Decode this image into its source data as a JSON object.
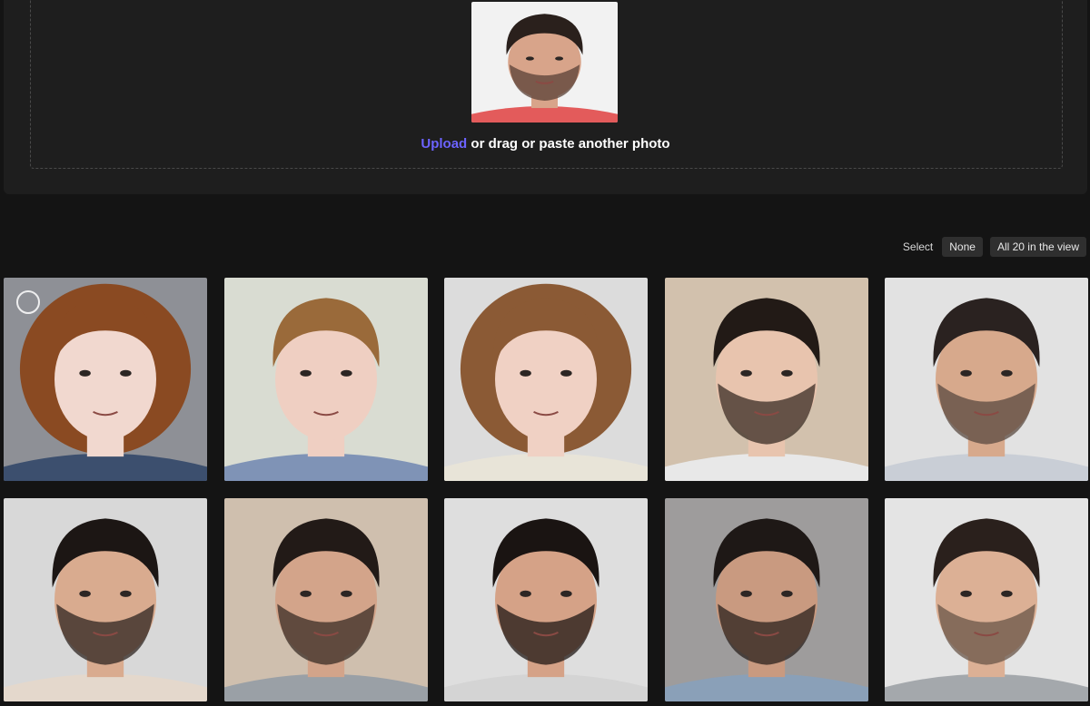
{
  "upload": {
    "link_label": "Upload",
    "rest_label": " or drag or paste another photo"
  },
  "select_bar": {
    "label": "Select",
    "none_label": "None",
    "all_label": "All 20 in the view"
  },
  "grid": {
    "items": [
      {
        "bg": "#8e9096",
        "skin": "#f1d8cf",
        "hair": "#8a4a22",
        "shirt": "#3c4f6e",
        "beard": null,
        "long_hair": true
      },
      {
        "bg": "#d9dcd2",
        "skin": "#efcfc2",
        "hair": "#9a6a3a",
        "shirt": "#7f93b6",
        "beard": null,
        "long_hair": false
      },
      {
        "bg": "#dcdcdc",
        "skin": "#f0d1c4",
        "hair": "#8b5a35",
        "shirt": "#e8e4d8",
        "beard": null,
        "long_hair": true
      },
      {
        "bg": "#d2c1ad",
        "skin": "#e8c4ae",
        "hair": "#221a16",
        "shirt": "#e8e8e8",
        "beard": "#3a2c24",
        "long_hair": false
      },
      {
        "bg": "#e2e2e2",
        "skin": "#d7a98c",
        "hair": "#2a2220",
        "shirt": "#c9ced6",
        "beard": "#5a4a40",
        "long_hair": false
      },
      {
        "bg": "#d8d8d8",
        "skin": "#d9ab8f",
        "hair": "#1c1614",
        "shirt": "#e4d8cc",
        "beard": "#2e2420",
        "long_hair": false
      },
      {
        "bg": "#cfbfae",
        "skin": "#d3a48a",
        "hair": "#221a17",
        "shirt": "#9aa0a6",
        "beard": "#3a2c24",
        "long_hair": false
      },
      {
        "bg": "#dedede",
        "skin": "#d5a287",
        "hair": "#1a1412",
        "shirt": "#d4d4d4",
        "beard": "#1f1714",
        "long_hair": false
      },
      {
        "bg": "#9e9c9c",
        "skin": "#c99a80",
        "hair": "#1e1816",
        "shirt": "#8aa0b8",
        "beard": "#2a201c",
        "long_hair": false
      },
      {
        "bg": "#e4e4e4",
        "skin": "#dcb095",
        "hair": "#2a201c",
        "shirt": "#a4a8ac",
        "beard": "#6a5648",
        "long_hair": false
      }
    ]
  },
  "colors": {
    "accent": "#6c63ff",
    "preview_bg": "#f2f2f2",
    "preview_skin": "#d8a48a",
    "preview_hair": "#2a201c",
    "preview_shirt": "#e35b5b",
    "preview_beard": "#5a4036"
  }
}
